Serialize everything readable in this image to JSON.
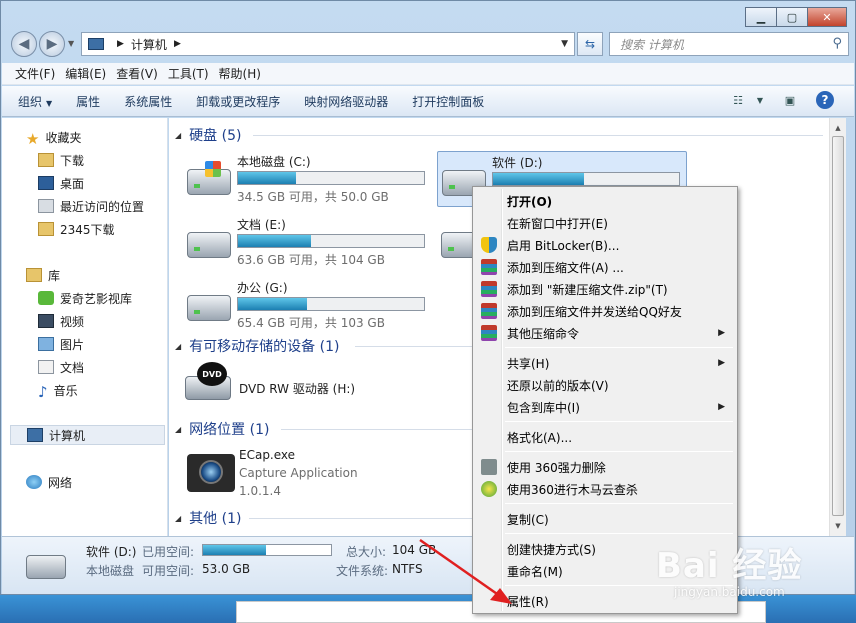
{
  "titlebar": {
    "minimize": "▁",
    "maximize": "▢",
    "close": "✕"
  },
  "address": {
    "crumb": "计算机",
    "search_placeholder": "搜索 计算机"
  },
  "menubar": [
    "文件(F)",
    "编辑(E)",
    "查看(V)",
    "工具(T)",
    "帮助(H)"
  ],
  "toolbar": [
    "组织",
    "属性",
    "系统属性",
    "卸载或更改程序",
    "映射网络驱动器",
    "打开控制面板"
  ],
  "nav": {
    "favorites": "收藏夹",
    "fav_items": [
      "下载",
      "桌面",
      "最近访问的位置",
      "2345下载"
    ],
    "libraries": "库",
    "lib_items": [
      "爱奇艺影视库",
      "视频",
      "图片",
      "文档",
      "音乐"
    ],
    "computer": "计算机",
    "network": "网络"
  },
  "groups": {
    "hard_disks": "硬盘 (5)",
    "removable": "有可移动存储的设备 (1)",
    "network": "网络位置 (1)",
    "other": "其他 (1)"
  },
  "drives": [
    {
      "name": "本地磁盘 (C:)",
      "info": "34.5 GB 可用，共 50.0 GB",
      "used_fraction": 0.31
    },
    {
      "name": "软件 (D:)",
      "info": "",
      "used_fraction": 0.49
    },
    {
      "name": "文档 (E:)",
      "info": "63.6 GB 可用，共 104 GB",
      "used_fraction": 0.39
    },
    {
      "name": "办公 (G:)",
      "info": "65.4 GB 可用，共 103 GB",
      "used_fraction": 0.37
    }
  ],
  "dvd": {
    "name": "DVD RW 驱动器 (H:)",
    "disc_label": "DVD"
  },
  "network_location": {
    "name": "ECap.exe",
    "desc": "Capture Application",
    "version": "1.0.1.4"
  },
  "details": {
    "name": "软件 (D:)",
    "type": "本地磁盘",
    "used_label": "已用空间:",
    "free_label": "可用空间:",
    "free_value": "53.0 GB",
    "total_label": "总大小:",
    "total_value": "104 GB",
    "fs_label": "文件系统:",
    "fs_value": "NTFS",
    "used_fraction": 0.49
  },
  "context_menu": {
    "open": "打开(O)",
    "open_new": "在新窗口中打开(E)",
    "bitlocker": "启用 BitLocker(B)...",
    "add_archive": "添加到压缩文件(A) ...",
    "add_zip": "添加到 \"新建压缩文件.zip\"(T)",
    "add_qq": "添加到压缩文件并发送给QQ好友",
    "other_compress": "其他压缩命令",
    "share": "共享(H)",
    "restore": "还原以前的版本(V)",
    "include_lib": "包含到库中(I)",
    "format": "格式化(A)...",
    "delete360": "使用 360强力删除",
    "scan360": "使用360进行木马云查杀",
    "copy": "复制(C)",
    "shortcut": "创建快捷方式(S)",
    "rename": "重命名(M)",
    "properties": "属性(R)"
  },
  "watermark": {
    "logo": "Bai 经验",
    "url": "jingyan.baidu.com"
  },
  "colors": {
    "accent_link": "#1e3f8a",
    "bar_fill": "#1c7fb2",
    "arrow": "#e02020"
  }
}
